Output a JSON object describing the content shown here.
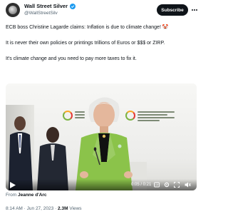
{
  "header": {
    "display_name": "Wall Street Silver",
    "handle": "@WallStreetSilv",
    "subscribe_label": "Subscribe"
  },
  "tweet": {
    "line1": "ECB boss Christine Lagarde claims: Inflation is due to climate change! 🤡",
    "line2": "It is never their own policies or printings trillions of Euros or $$$ or ZIRP.",
    "line3": "It's climate change and you need to pay more taxes to fix it."
  },
  "video": {
    "time_display": "0:05 / 0:21",
    "progress": 0.24
  },
  "attribution": {
    "from_label": "From",
    "author": "Jeanne d'Arc"
  },
  "meta": {
    "time": "8:14 AM",
    "date": "Jun 27, 2023",
    "separator": "·",
    "views_count": "2.3M",
    "views_label": "Views"
  },
  "colors": {
    "accent_verified": "#1d9bf0",
    "subscribe_bg": "#0f1419",
    "jacket_green": "#8bc34a"
  },
  "icons": {
    "verified": "verified-badge-icon",
    "more": "more-options-icon",
    "play": "play-icon",
    "gif": "gif-icon",
    "settings": "settings-gear-icon",
    "fullscreen": "fullscreen-icon",
    "volume": "volume-icon"
  }
}
